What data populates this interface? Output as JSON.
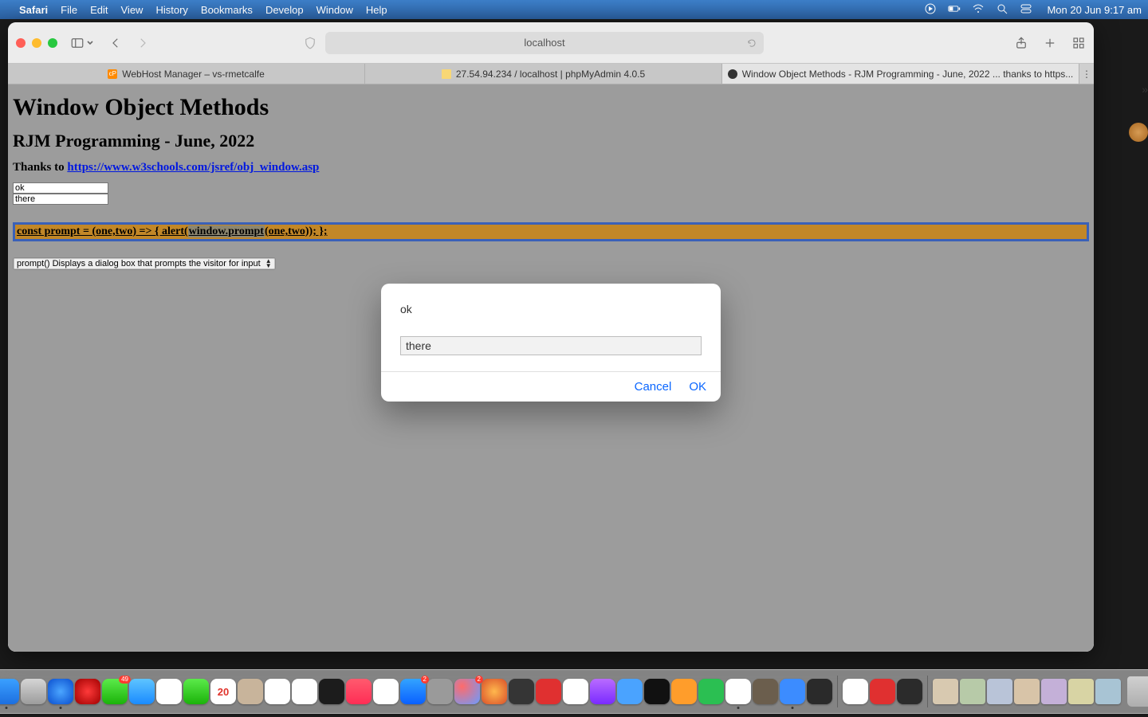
{
  "menubar": {
    "apple": "",
    "appname": "Safari",
    "items": [
      "File",
      "Edit",
      "View",
      "History",
      "Bookmarks",
      "Develop",
      "Window",
      "Help"
    ],
    "clock": "Mon 20 Jun  9:17 am"
  },
  "safari": {
    "url": "localhost",
    "tabs": [
      {
        "label": "WebHost Manager – vs-rmetcalfe"
      },
      {
        "label": "27.54.94.234 / localhost | phpMyAdmin 4.0.5"
      },
      {
        "label": "Window Object Methods - RJM Programming - June, 2022 ... thanks to https..."
      }
    ],
    "activeTab": 2
  },
  "page": {
    "h1": "Window Object Methods",
    "h2": "RJM Programming - June, 2022",
    "thanks_prefix": "Thanks to ",
    "thanks_link": "https://www.w3schools.com/jsref/obj_window.asp",
    "input1": "ok",
    "input2": "there",
    "code": {
      "p1": "const prompt = (one,two) => { alert(",
      "hl": "window.prompt",
      "p2": "(one,two)); };"
    },
    "select_value": "prompt() Displays a dialog box that prompts the visitor for input"
  },
  "dialog": {
    "message": "ok",
    "input_value": "there",
    "cancel": "Cancel",
    "ok": "OK"
  },
  "dock": {
    "apps": [
      {
        "name": "finder",
        "bg": "linear-gradient(#3aa0ff,#1d6fe0)",
        "running": true
      },
      {
        "name": "launchpad",
        "bg": "linear-gradient(#d5d5d5,#9c9c9c)"
      },
      {
        "name": "safari",
        "bg": "radial-gradient(circle,#4ba6ff,#0a4ecf)",
        "running": true
      },
      {
        "name": "opera",
        "bg": "radial-gradient(circle,#ff3a3a,#a00000)"
      },
      {
        "name": "messages",
        "bg": "linear-gradient(#5bea4a,#1bb30a)",
        "badge": "49"
      },
      {
        "name": "mail",
        "bg": "linear-gradient(#5ec4ff,#1a8bff)"
      },
      {
        "name": "photos",
        "bg": "#fff"
      },
      {
        "name": "facetime",
        "bg": "linear-gradient(#5bea4a,#1bb30a)"
      },
      {
        "name": "calendar",
        "bg": "#fff",
        "text": "20"
      },
      {
        "name": "contacts",
        "bg": "#c8b49b"
      },
      {
        "name": "reminders",
        "bg": "#fff"
      },
      {
        "name": "notes",
        "bg": "#fff"
      },
      {
        "name": "tv",
        "bg": "#1c1c1c"
      },
      {
        "name": "music",
        "bg": "linear-gradient(#ff5a6e,#ff2d55)"
      },
      {
        "name": "news",
        "bg": "#fff"
      },
      {
        "name": "appstore",
        "bg": "linear-gradient(#33a3ff,#0a60ff)",
        "badge": "2"
      },
      {
        "name": "sysprefs",
        "bg": "#9a9a9a"
      },
      {
        "name": "palette",
        "bg": "radial-gradient(circle at 30% 30%,#ff6b6b,#6b9bff)",
        "badge": "2"
      },
      {
        "name": "firefox",
        "bg": "radial-gradient(circle,#ffb84d,#d94f2a)"
      },
      {
        "name": "calc",
        "bg": "#353535"
      },
      {
        "name": "filezilla",
        "bg": "#e03030"
      },
      {
        "name": "brackets",
        "bg": "#fff"
      },
      {
        "name": "podcasts",
        "bg": "linear-gradient(#b96bff,#7a2bff)"
      },
      {
        "name": "xcode",
        "bg": "#4aa3ff"
      },
      {
        "name": "terminal",
        "bg": "#111"
      },
      {
        "name": "pages",
        "bg": "#ff9d2b"
      },
      {
        "name": "numbers",
        "bg": "#2bbf52"
      },
      {
        "name": "textedit",
        "bg": "#fff",
        "running": true
      },
      {
        "name": "gimp",
        "bg": "#6b5e4d"
      },
      {
        "name": "zoom",
        "bg": "#3c8cff",
        "running": true
      },
      {
        "name": "intellij",
        "bg": "#2a2a2a"
      }
    ],
    "right": [
      {
        "name": "chrome",
        "bg": "#fff"
      },
      {
        "name": "parallels",
        "bg": "#e03030"
      },
      {
        "name": "console",
        "bg": "#2b2b2b"
      }
    ],
    "stacks": [
      {
        "name": "stack1",
        "bg": "#d8c9b0"
      },
      {
        "name": "stack2",
        "bg": "#b7caa8"
      },
      {
        "name": "stack3",
        "bg": "#b9c4d8"
      },
      {
        "name": "stack4",
        "bg": "#d8c4a8"
      },
      {
        "name": "stack5",
        "bg": "#c4b0d8"
      },
      {
        "name": "stack6",
        "bg": "#d8d4a4"
      },
      {
        "name": "stack7",
        "bg": "#a8c4d4"
      }
    ]
  }
}
